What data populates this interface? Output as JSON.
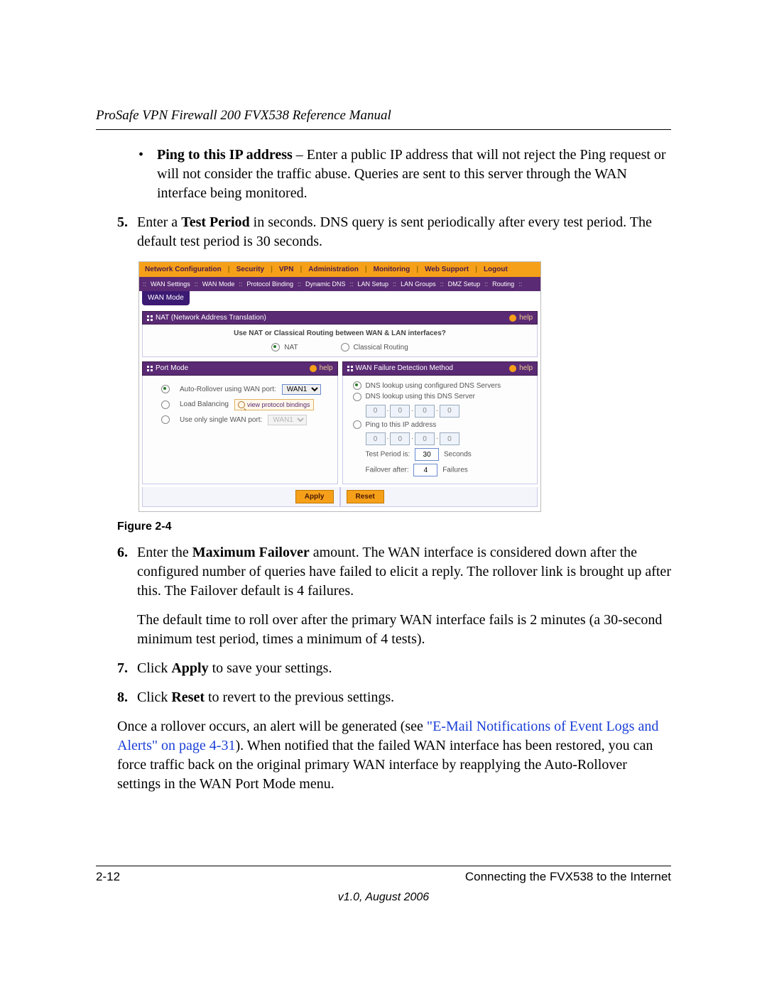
{
  "header": "ProSafe VPN Firewall 200 FVX538 Reference Manual",
  "bullet": {
    "lead": "Ping to this IP address",
    "rest": " – Enter a public IP address that will not reject the Ping request or will not consider the traffic abuse. Queries are sent to this server through the WAN interface being monitored."
  },
  "step5": {
    "n": "5.",
    "pre": "Enter a ",
    "bold": "Test Period",
    "post": " in seconds. DNS query is sent periodically after every test period. The default test period is 30 seconds."
  },
  "figcap": "Figure 2-4",
  "step6": {
    "n": "6.",
    "pre": "Enter the ",
    "bold": "Maximum Failover",
    "post": " amount. The WAN interface is considered down after the configured number of queries have failed to elicit a reply. The rollover link is brought up after this. The Failover default is 4 failures."
  },
  "step6b": "The default time to roll over after the primary WAN interface fails is 2 minutes (a 30-second minimum test period, times a minimum of 4 tests).",
  "step7": {
    "n": "7.",
    "pre": "Click ",
    "bold": "Apply",
    "post": " to save your settings."
  },
  "step8": {
    "n": "8.",
    "pre": "Click ",
    "bold": "Reset",
    "post": " to revert to the previous settings."
  },
  "para_end": {
    "a": "Once a rollover occurs, an alert will be generated (see ",
    "link": "\"E-Mail Notifications of Event Logs and Alerts\" on page 4-31",
    "b": "). When notified that the failed WAN interface has been restored, you can force traffic back on the original primary WAN interface by reapplying the Auto-Rollover settings in the WAN Port Mode menu."
  },
  "footer": {
    "left": "2-12",
    "right": "Connecting the FVX538 to the Internet",
    "ver": "v1.0, August 2006"
  },
  "ui": {
    "top": [
      "Network Configuration",
      "Security",
      "VPN",
      "Administration",
      "Monitoring",
      "Web Support",
      "Logout"
    ],
    "sub": [
      "WAN Settings",
      "WAN Mode",
      "Protocol Binding",
      "Dynamic DNS",
      "LAN Setup",
      "LAN Groups",
      "DMZ Setup",
      "Routing"
    ],
    "tag": "WAN Mode",
    "help": "help",
    "nat": {
      "title": "NAT (Network Address Translation)",
      "q": "Use NAT or Classical Routing between WAN & LAN interfaces?",
      "opt1": "NAT",
      "opt2": "Classical Routing"
    },
    "pm": {
      "title": "Port Mode",
      "opt1_pre": "Auto-Rollover using WAN port:",
      "opt1_sel": "WAN1",
      "opt2": "Load Balancing",
      "opt2_link": "view protocol bindings",
      "opt3_pre": "Use only single WAN port:",
      "opt3_sel": "WAN1"
    },
    "wfd": {
      "title": "WAN Failure Detection Method",
      "opt1": "DNS lookup using configured DNS Servers",
      "opt2": "DNS lookup using this DNS Server",
      "opt3": "Ping to this IP address",
      "tp_pre": "Test Period is:",
      "tp_val": "30",
      "tp_post": "Seconds",
      "fo_pre": "Failover after:",
      "fo_val": "4",
      "fo_post": "Failures",
      "ip": [
        "0",
        "0",
        "0",
        "0"
      ]
    },
    "apply": "Apply",
    "reset": "Reset"
  }
}
